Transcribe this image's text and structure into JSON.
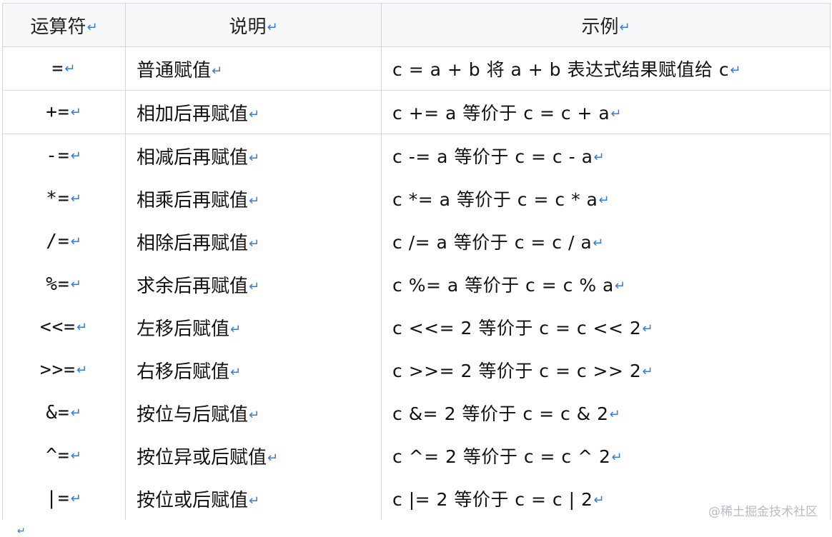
{
  "table": {
    "headers": [
      "运算符",
      "说明",
      "示例"
    ],
    "rows": [
      {
        "op": "=",
        "desc": "普通赋值",
        "example": "c = a + b 将 a + b 表达式结果赋值给 c"
      },
      {
        "op": "+=",
        "desc": "相加后再赋值",
        "example": "c += a 等价于 c = c + a"
      },
      {
        "op": "-=",
        "desc": "相减后再赋值",
        "example": "c -= a 等价于 c = c - a"
      },
      {
        "op": "*=",
        "desc": "相乘后再赋值",
        "example": "c *= a 等价于 c = c * a"
      },
      {
        "op": "/=",
        "desc": "相除后再赋值",
        "example": "c /= a 等价于 c = c / a"
      },
      {
        "op": "%=",
        "desc": "求余后再赋值",
        "example": "c %= a 等价于 c = c % a"
      },
      {
        "op": "<<=",
        "desc": "左移后赋值",
        "example": "c <<= 2 等价于 c = c << 2"
      },
      {
        "op": ">>=",
        "desc": "右移后赋值",
        "example": "c >>= 2 等价于 c = c >> 2"
      },
      {
        "op": "&=",
        "desc": "按位与后赋值",
        "example": "c &= 2 等价于 c = c & 2"
      },
      {
        "op": "^=",
        "desc": "按位异或后赋值",
        "example": "c ^= 2 等价于 c = c ^ 2"
      },
      {
        "op": "|=",
        "desc": "按位或后赋值",
        "example": "c |= 2 等价于 c = c | 2"
      }
    ]
  },
  "return_mark": "↵",
  "watermark": "@稀土掘金技术社区",
  "colors": {
    "return_mark": "#2f7de1",
    "border": "#cfd6df",
    "header_bg": "#f7f8fa"
  }
}
